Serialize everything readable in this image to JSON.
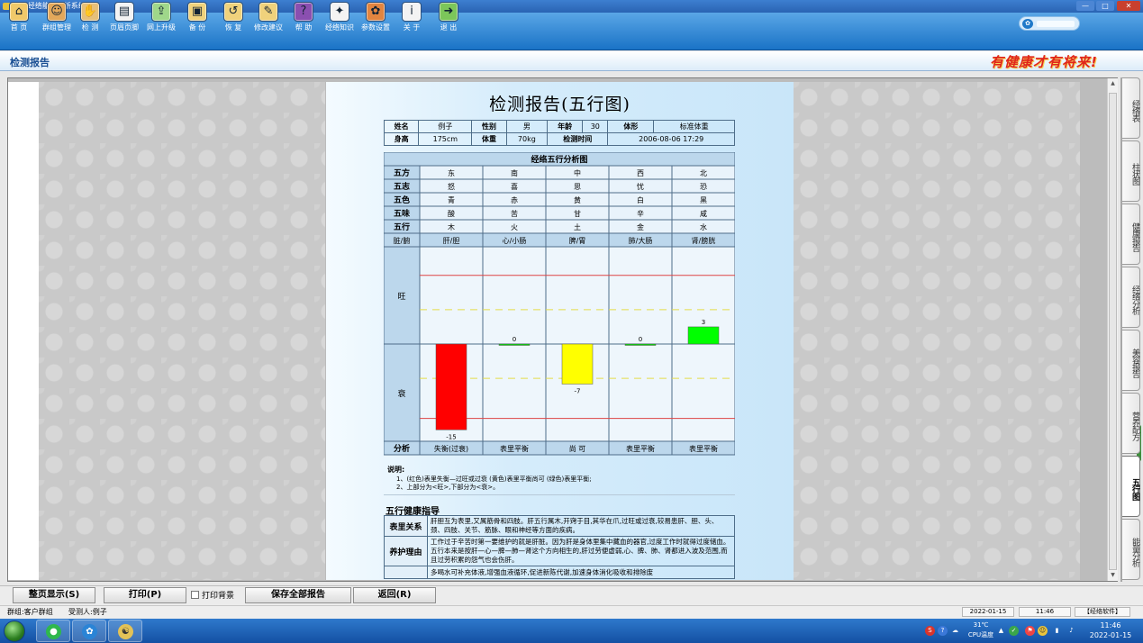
{
  "window": {
    "title": "TCT经络能量分析系统",
    "min": "—",
    "max": "□",
    "close": "✕"
  },
  "toolbar": {
    "items": [
      {
        "label": "首 页",
        "icon": "home-icon",
        "glyph": "⌂",
        "color": "#f0c96a"
      },
      {
        "label": "群组管理",
        "icon": "group-icon",
        "glyph": "☺",
        "color": "#e3a85b"
      },
      {
        "label": "检 测",
        "icon": "hand-icon",
        "glyph": "✋",
        "color": "#e6c07a"
      },
      {
        "label": "页眉页脚",
        "icon": "page-icon",
        "glyph": "▤",
        "color": "#f3f3f3"
      },
      {
        "label": "网上升级",
        "icon": "upgrade-icon",
        "glyph": "⇪",
        "color": "#9fd78a"
      },
      {
        "label": "备 份",
        "icon": "backup-icon",
        "glyph": "▣",
        "color": "#f0d27c"
      },
      {
        "label": "恢 复",
        "icon": "restore-icon",
        "glyph": "↺",
        "color": "#f0d27c"
      },
      {
        "label": "修改建议",
        "icon": "edit-icon",
        "glyph": "✎",
        "color": "#f0d27c"
      },
      {
        "label": "帮 助",
        "icon": "help-icon",
        "glyph": "?",
        "color": "#8a4fb0"
      },
      {
        "label": "经络知识",
        "icon": "book-icon",
        "glyph": "✦",
        "color": "#f3f3f3"
      },
      {
        "label": "参数设置",
        "icon": "settings-icon",
        "glyph": "✿",
        "color": "#e28540"
      },
      {
        "label": "关 于",
        "icon": "about-icon",
        "glyph": "i",
        "color": "#f3f3f3"
      },
      {
        "label": "退 出",
        "icon": "exit-icon",
        "glyph": "➜",
        "color": "#7cc65a"
      }
    ]
  },
  "header": {
    "title": "检测报告",
    "slogan": "有健康才有将来!"
  },
  "report": {
    "title": "检测报告(五行图)",
    "info": {
      "name_label": "姓名",
      "name": "例子",
      "sex_label": "性别",
      "sex": "男",
      "age_label": "年龄",
      "age": "30",
      "body_label": "体形",
      "body": "标准体重",
      "height_label": "身高",
      "height": "175cm",
      "weight_label": "体重",
      "weight": "70kg",
      "time_label": "检测时间",
      "time": "2006-08-06 17:29"
    },
    "chart_title": "经络五行分析图",
    "rows": [
      {
        "label": "五方",
        "values": [
          "东",
          "南",
          "中",
          "西",
          "北"
        ]
      },
      {
        "label": "五志",
        "values": [
          "怒",
          "喜",
          "思",
          "忧",
          "恐"
        ]
      },
      {
        "label": "五色",
        "values": [
          "青",
          "赤",
          "黄",
          "白",
          "黑"
        ]
      },
      {
        "label": "五味",
        "values": [
          "酸",
          "苦",
          "甘",
          "辛",
          "咸"
        ]
      },
      {
        "label": "五行",
        "values": [
          "木",
          "火",
          "土",
          "金",
          "水"
        ]
      }
    ],
    "organ_label": "脏/腑",
    "organs": [
      "肝/胆",
      "心/小肠",
      "脾/胃",
      "肺/大肠",
      "肾/膀胱"
    ],
    "wang_label": "旺",
    "shuai_label": "衰",
    "analysis_label": "分析",
    "analysis": [
      "失衡(过衰)",
      "表里平衡",
      "尚 可",
      "表里平衡",
      "表里平衡"
    ],
    "notes_title": "说明:",
    "notes": [
      "1、(红色)表里失衡—过旺或过衰 (黄色)表里平衡尚可 (绿色)表里平衡;",
      "2、上部分为<旺>,下部分为<衰>。"
    ],
    "guide_title": "五行健康指导",
    "guide": [
      {
        "label": "表里关系",
        "text": "肝胆互为表里,又属筋骨和四肢。肝五行属木,开窍于目,其华在爪,过旺或过衰,较易患肝、胆、头、颈、四肢、关节、筋脉、眼和神经等方面的疾病。"
      },
      {
        "label": "养护理由",
        "text": "工作过于辛苦时第一要维护的就是肝脏。因为肝是身体里集中藏血的器官,过度工作时就得过度储血。五行本来是按肝—心—脾—肺—肾这个方向相生的,肝过劳便虚弱,心、脾、肺、肾都进入波及范围,而且过劳积累的怨气也会伤肝。"
      },
      {
        "label": "",
        "text": "多喝水可补充体液,增强血液循环,促进新陈代谢,加速身体消化吸收和排除废"
      }
    ]
  },
  "chart_data": {
    "type": "bar",
    "title": "经络五行分析图",
    "categories": [
      "肝/胆",
      "心/小肠",
      "脾/胃",
      "肺/大肠",
      "肾/膀胱"
    ],
    "values": [
      -15,
      0,
      -7,
      0,
      3
    ],
    "value_labels": [
      "-15",
      "0",
      "-7",
      "0",
      "3"
    ],
    "colors": [
      "#ff0000",
      "#00dd00",
      "#ffff00",
      "#00dd00",
      "#00ff00"
    ],
    "ylim": [
      -17,
      17
    ],
    "reference_lines": {
      "red": [
        -13,
        12
      ],
      "yellow_dashed": [
        -6,
        6
      ]
    },
    "ylabel_upper": "旺",
    "ylabel_lower": "衰",
    "grid": true
  },
  "right_tabs": [
    "经络表",
    "柱状图",
    "健康报告",
    "经络分析",
    "美容报告",
    "营养配方",
    "五行图",
    "能量分析"
  ],
  "active_tab": "五行图",
  "buttons": {
    "full": "整页显示(S)",
    "print": "打印(P)",
    "print_bg": "打印背景",
    "save": "保存全部报告",
    "back": "返回(R)"
  },
  "status": {
    "group": "群组:客户群组",
    "subject": "受测人:例子",
    "date": "2022-01-15",
    "time": "11:46",
    "software": "【经络软件】"
  },
  "taskbar": {
    "temp": "31℃",
    "cpu": "CPU温度",
    "clock_time": "11:46",
    "clock_date": "2022-01-15"
  }
}
